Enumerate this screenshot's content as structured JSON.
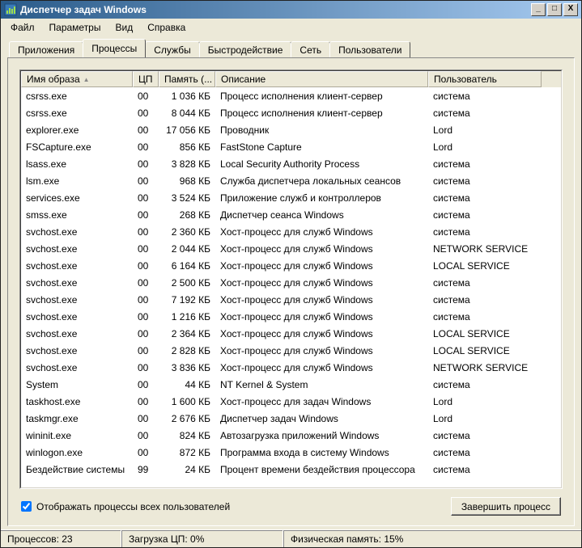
{
  "window": {
    "title": "Диспетчер задач Windows",
    "icon": "taskmgr-icon"
  },
  "win_buttons": {
    "min": "_",
    "max": "□",
    "close": "X"
  },
  "menu": [
    "Файл",
    "Параметры",
    "Вид",
    "Справка"
  ],
  "tabs": [
    {
      "label": "Приложения",
      "active": false
    },
    {
      "label": "Процессы",
      "active": true
    },
    {
      "label": "Службы",
      "active": false
    },
    {
      "label": "Быстродействие",
      "active": false
    },
    {
      "label": "Сеть",
      "active": false
    },
    {
      "label": "Пользователи",
      "active": false
    }
  ],
  "columns": [
    {
      "label": "Имя образа",
      "cls": "c-name",
      "sort": true
    },
    {
      "label": "ЦП",
      "cls": "c-cpu"
    },
    {
      "label": "Память (...",
      "cls": "c-mem"
    },
    {
      "label": "Описание",
      "cls": "c-desc"
    },
    {
      "label": "Пользователь",
      "cls": "c-user"
    }
  ],
  "rows": [
    {
      "name": "csrss.exe",
      "cpu": "00",
      "mem": "1 036 КБ",
      "desc": "Процесс исполнения клиент-сервер",
      "user": "система"
    },
    {
      "name": "csrss.exe",
      "cpu": "00",
      "mem": "8 044 КБ",
      "desc": "Процесс исполнения клиент-сервер",
      "user": "система"
    },
    {
      "name": "explorer.exe",
      "cpu": "00",
      "mem": "17 056 КБ",
      "desc": "Проводник",
      "user": "Lord"
    },
    {
      "name": "FSCapture.exe",
      "cpu": "00",
      "mem": "856 КБ",
      "desc": "FastStone Capture",
      "user": "Lord"
    },
    {
      "name": "lsass.exe",
      "cpu": "00",
      "mem": "3 828 КБ",
      "desc": "Local Security Authority Process",
      "user": "система"
    },
    {
      "name": "lsm.exe",
      "cpu": "00",
      "mem": "968 КБ",
      "desc": "Служба диспетчера локальных сеансов",
      "user": "система"
    },
    {
      "name": "services.exe",
      "cpu": "00",
      "mem": "3 524 КБ",
      "desc": "Приложение служб и контроллеров",
      "user": "система"
    },
    {
      "name": "smss.exe",
      "cpu": "00",
      "mem": "268 КБ",
      "desc": "Диспетчер сеанса  Windows",
      "user": "система"
    },
    {
      "name": "svchost.exe",
      "cpu": "00",
      "mem": "2 360 КБ",
      "desc": "Хост-процесс для служб Windows",
      "user": "система"
    },
    {
      "name": "svchost.exe",
      "cpu": "00",
      "mem": "2 044 КБ",
      "desc": "Хост-процесс для служб Windows",
      "user": "NETWORK SERVICE"
    },
    {
      "name": "svchost.exe",
      "cpu": "00",
      "mem": "6 164 КБ",
      "desc": "Хост-процесс для служб Windows",
      "user": "LOCAL SERVICE"
    },
    {
      "name": "svchost.exe",
      "cpu": "00",
      "mem": "2 500 КБ",
      "desc": "Хост-процесс для служб Windows",
      "user": "система"
    },
    {
      "name": "svchost.exe",
      "cpu": "00",
      "mem": "7 192 КБ",
      "desc": "Хост-процесс для служб Windows",
      "user": "система"
    },
    {
      "name": "svchost.exe",
      "cpu": "00",
      "mem": "1 216 КБ",
      "desc": "Хост-процесс для служб Windows",
      "user": "система"
    },
    {
      "name": "svchost.exe",
      "cpu": "00",
      "mem": "2 364 КБ",
      "desc": "Хост-процесс для служб Windows",
      "user": "LOCAL SERVICE"
    },
    {
      "name": "svchost.exe",
      "cpu": "00",
      "mem": "2 828 КБ",
      "desc": "Хост-процесс для служб Windows",
      "user": "LOCAL SERVICE"
    },
    {
      "name": "svchost.exe",
      "cpu": "00",
      "mem": "3 836 КБ",
      "desc": "Хост-процесс для служб Windows",
      "user": "NETWORK SERVICE"
    },
    {
      "name": "System",
      "cpu": "00",
      "mem": "44 КБ",
      "desc": "NT Kernel & System",
      "user": "система"
    },
    {
      "name": "taskhost.exe",
      "cpu": "00",
      "mem": "1 600 КБ",
      "desc": "Хост-процесс для задач Windows",
      "user": "Lord"
    },
    {
      "name": "taskmgr.exe",
      "cpu": "00",
      "mem": "2 676 КБ",
      "desc": "Диспетчер задач Windows",
      "user": "Lord"
    },
    {
      "name": "wininit.exe",
      "cpu": "00",
      "mem": "824 КБ",
      "desc": "Автозагрузка приложений Windows",
      "user": "система"
    },
    {
      "name": "winlogon.exe",
      "cpu": "00",
      "mem": "872 КБ",
      "desc": "Программа входа в систему Windows",
      "user": "система"
    },
    {
      "name": "Бездействие системы",
      "cpu": "99",
      "mem": "24 КБ",
      "desc": "Процент времени бездействия процессора",
      "user": "система"
    }
  ],
  "footer": {
    "checkbox_label": "Отображать процессы всех пользователей",
    "checkbox_checked": true,
    "end_button": "Завершить процесс"
  },
  "status": {
    "processes": "Процессов: 23",
    "cpu": "Загрузка ЦП: 0%",
    "mem": "Физическая память: 15%"
  }
}
